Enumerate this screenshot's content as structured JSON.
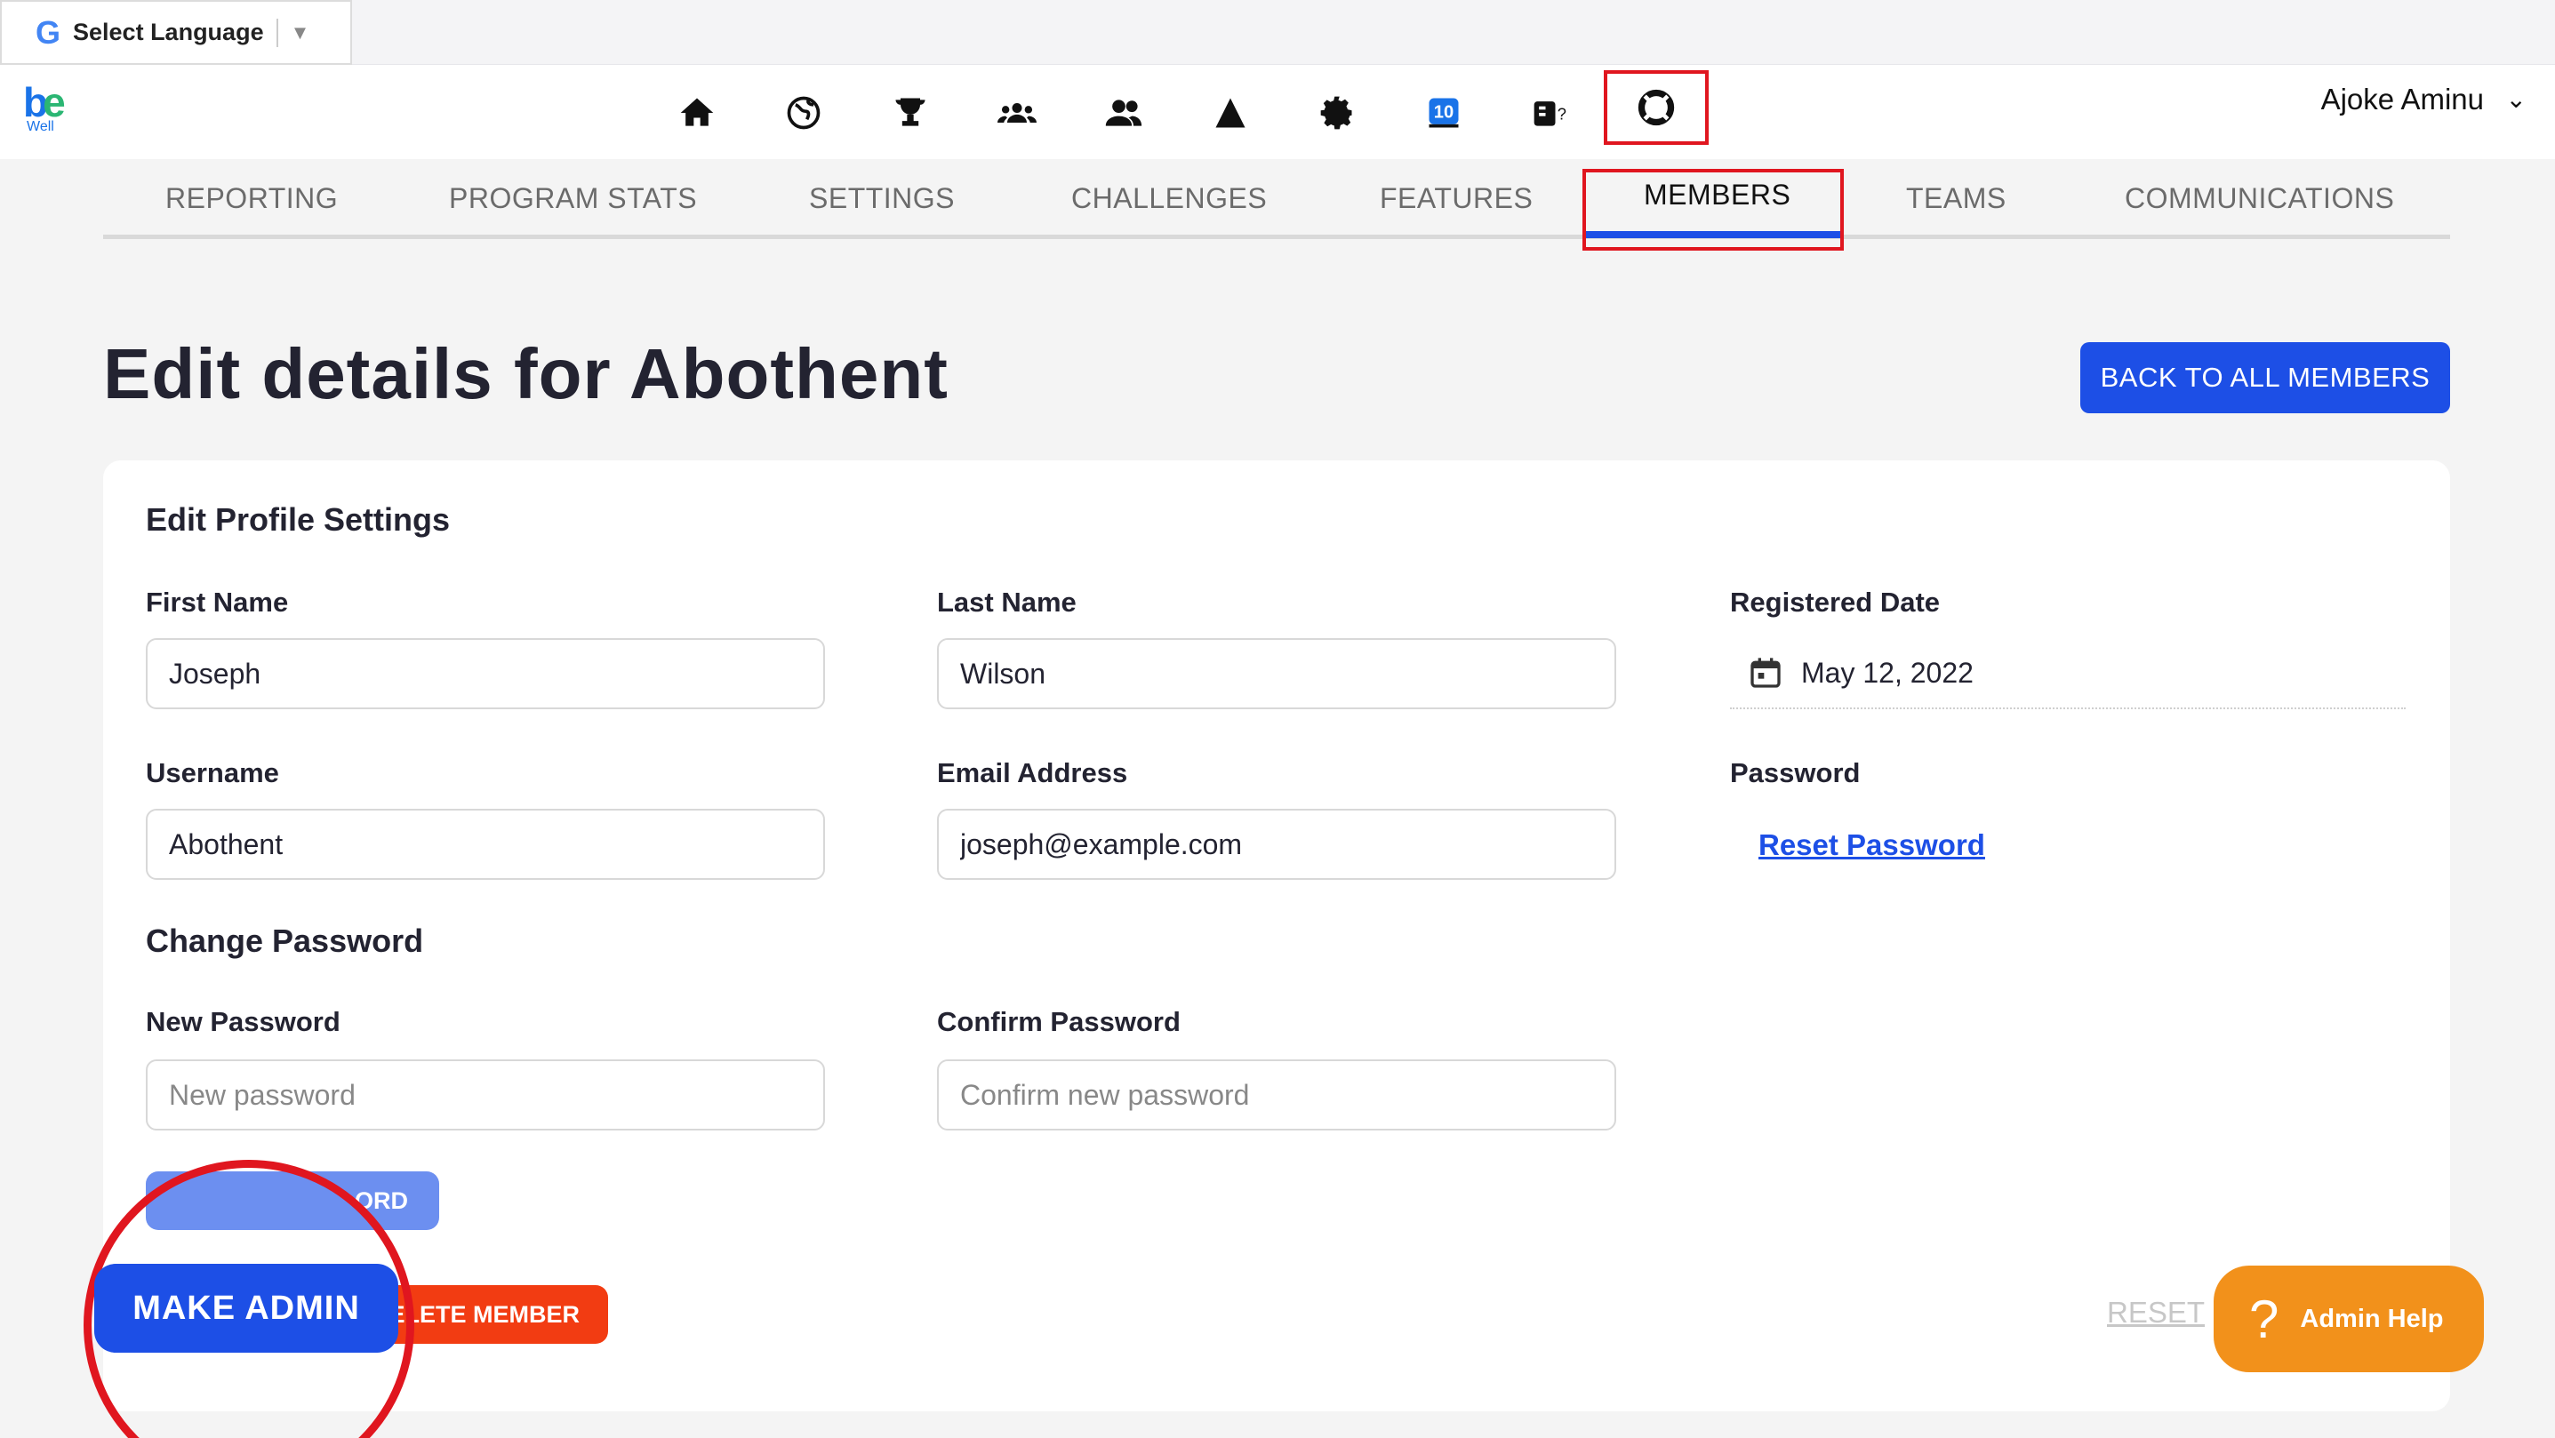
{
  "translate": {
    "g": "G",
    "label": "Select Language",
    "arrow": "▼"
  },
  "logo": {
    "be": "be",
    "well": "Well"
  },
  "nav_icons": [
    "home-icon",
    "globe-icon",
    "trophy-icon",
    "group-icon",
    "members-icon",
    "arrow-up-icon",
    "gear-icon",
    "ten-badge-icon",
    "quiz-icon",
    "lifebuoy-icon"
  ],
  "user": {
    "name": "Ajoke Aminu",
    "chevron": "⌄"
  },
  "tabs": [
    {
      "label": "REPORTING"
    },
    {
      "label": "PROGRAM STATS"
    },
    {
      "label": "SETTINGS"
    },
    {
      "label": "CHALLENGES"
    },
    {
      "label": "FEATURES"
    },
    {
      "label": "MEMBERS"
    },
    {
      "label": "TEAMS"
    },
    {
      "label": "COMMUNICATIONS"
    }
  ],
  "page": {
    "title": "Edit details for Abothent",
    "back_button": "BACK TO ALL MEMBERS"
  },
  "profile": {
    "section_title": "Edit Profile Settings",
    "first_name_label": "First Name",
    "first_name_value": "Joseph",
    "last_name_label": "Last Name",
    "last_name_value": "Wilson",
    "registered_label": "Registered Date",
    "registered_value": "May 12, 2022",
    "username_label": "Username",
    "username_value": "Abothent",
    "email_label": "Email Address",
    "email_value": "joseph@example.com",
    "password_label": "Password",
    "reset_password_link": "Reset Password"
  },
  "change_password": {
    "section_title": "Change Password",
    "new_label": "New Password",
    "new_placeholder": "New password",
    "confirm_label": "Confirm Password",
    "confirm_placeholder": "Confirm new password",
    "button_visible": "ORD"
  },
  "actions": {
    "make_admin": "MAKE ADMIN",
    "delete_member_visible": "ELETE MEMBER",
    "reset": "RESET"
  },
  "admin_help": {
    "icon": "?",
    "label": "Admin Help"
  },
  "colors": {
    "accent": "#1d4fe6",
    "danger": "#f23c12",
    "help": "#f2911b",
    "highlight": "#e0161f"
  }
}
